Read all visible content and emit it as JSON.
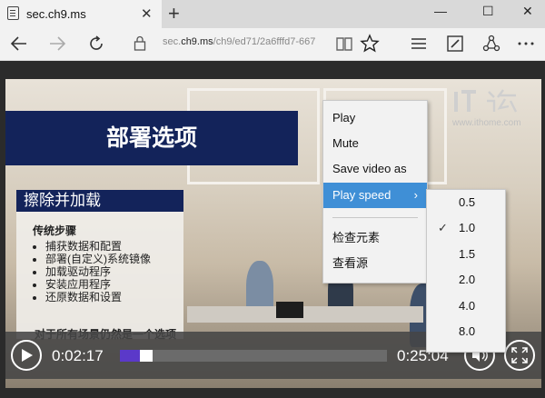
{
  "browser": {
    "tab_title": "sec.ch9.ms",
    "tab_close": "✕",
    "new_tab": "+",
    "window_controls": {
      "minimize": "—",
      "maximize": "☐",
      "close": "✕"
    },
    "address": {
      "host_prefix": "sec.",
      "host": "ch9.ms",
      "path": "/ch9/ed71/2a6fffd7-667"
    },
    "icons": [
      "back-icon",
      "forward-icon",
      "refresh-icon",
      "lock-icon",
      "reading-view-icon",
      "favorite-star-icon",
      "hub-icon",
      "web-note-icon",
      "share-icon",
      "more-icon"
    ]
  },
  "slide": {
    "title": "部署选项",
    "subtitle": "擦除并加载",
    "heading": "传统步骤",
    "bullets": [
      "捕获数据和配置",
      "部署(自定义)系统镜像",
      "加载驱动程序",
      "安装应用程序",
      "还原数据和设置"
    ],
    "footer": "对于所有场景仍然是一个选项"
  },
  "watermark": {
    "site": "www.ithome.com"
  },
  "player": {
    "current_time": "0:02:17",
    "duration": "0:25:04",
    "progress": 0.075,
    "accent_color": "#5b39c9"
  },
  "context_menu": {
    "items": [
      "Play",
      "Mute",
      "Save video as",
      "Play speed",
      "检查元素",
      "查看源"
    ],
    "active_item": "Play speed",
    "submenu_arrow": "›"
  },
  "speed_submenu": {
    "options": [
      "0.5",
      "1.0",
      "1.5",
      "2.0",
      "4.0",
      "8.0"
    ],
    "selected": "1.0",
    "check": "✓"
  }
}
